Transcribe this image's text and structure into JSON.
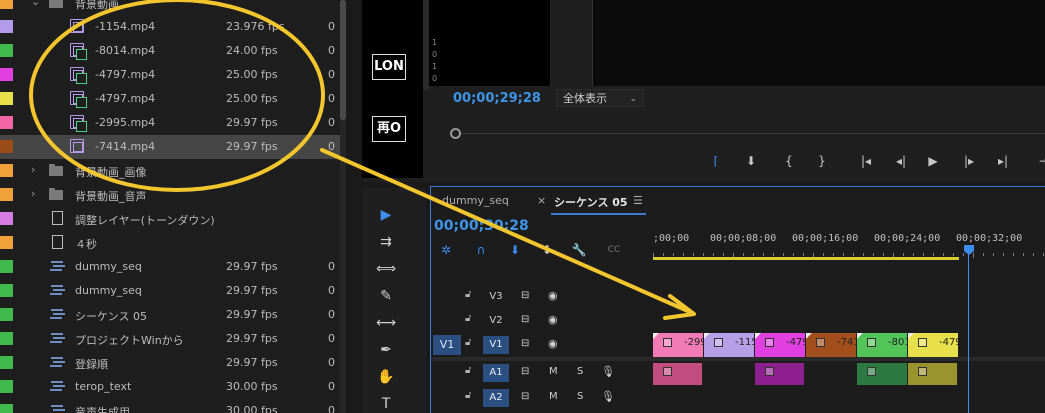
{
  "project": {
    "rows": [
      {
        "kind": "folder",
        "expanded": true,
        "indent": 1,
        "name": "背景動画",
        "fps": "",
        "extra": "",
        "swatch": "#f0a23a"
      },
      {
        "kind": "clip",
        "indent": 2,
        "name": "-1154.mp4",
        "fps": "23.976 fps",
        "extra": "0",
        "swatch": "#b29be8"
      },
      {
        "kind": "clipv",
        "indent": 2,
        "name": "-8014.mp4",
        "fps": "24.00 fps",
        "extra": "0",
        "swatch": "#3fb94e"
      },
      {
        "kind": "clipv",
        "indent": 2,
        "name": "-4797.mp4",
        "fps": "25.00 fps",
        "extra": "0",
        "swatch": "#e040e0"
      },
      {
        "kind": "clipv",
        "indent": 2,
        "name": "-4797.mp4",
        "fps": "25.00 fps",
        "extra": "0",
        "swatch": "#e8e04a"
      },
      {
        "kind": "clipv",
        "indent": 2,
        "name": "-2995.mp4",
        "fps": "29.97 fps",
        "extra": "0",
        "swatch": "#f266a6"
      },
      {
        "kind": "clip",
        "indent": 2,
        "name": "-7414.mp4",
        "fps": "29.97 fps",
        "extra": "0",
        "swatch": "#9a4b18",
        "selected": true
      },
      {
        "kind": "folder",
        "expanded": false,
        "indent": 1,
        "name": "背景動画_画像",
        "fps": "",
        "extra": "",
        "swatch": "#f0a23a"
      },
      {
        "kind": "folder",
        "expanded": false,
        "indent": 1,
        "name": "背景動画_音声",
        "fps": "",
        "extra": "",
        "swatch": "#f0a23a"
      },
      {
        "kind": "doc",
        "indent": 1,
        "name": "調整レイヤー(トーンダウン)",
        "fps": "",
        "extra": "",
        "swatch": "#d77ce3"
      },
      {
        "kind": "doc",
        "indent": 1,
        "name": "４秒",
        "fps": "",
        "extra": "",
        "swatch": "#f0a23a"
      },
      {
        "kind": "seq",
        "indent": 1,
        "name": "dummy_seq",
        "fps": "29.97 fps",
        "extra": "0",
        "swatch": "#3fb94e"
      },
      {
        "kind": "seq",
        "indent": 1,
        "name": "dummy_seq",
        "fps": "29.97 fps",
        "extra": "0",
        "swatch": "#3fb94e"
      },
      {
        "kind": "seq",
        "indent": 1,
        "name": "シーケンス 05",
        "fps": "29.97 fps",
        "extra": "0",
        "swatch": "#3fb94e"
      },
      {
        "kind": "seq",
        "indent": 1,
        "name": "プロジェクトWinから",
        "fps": "29.97 fps",
        "extra": "0",
        "swatch": "#3fb94e"
      },
      {
        "kind": "seq",
        "indent": 1,
        "name": "登録順",
        "fps": "29.97 fps",
        "extra": "0",
        "swatch": "#3fb94e"
      },
      {
        "kind": "seq",
        "indent": 1,
        "name": "terop_text",
        "fps": "30.00 fps",
        "extra": "0",
        "swatch": "#3fb94e"
      },
      {
        "kind": "seq",
        "indent": 1,
        "name": "音声生成用",
        "fps": "30.00 fps",
        "extra": "0",
        "swatch": "#3fb94e"
      }
    ]
  },
  "monitor": {
    "left_boxes": [
      "LON",
      "再O"
    ],
    "ruler_numbers": [
      "1",
      "0",
      "1",
      "0"
    ],
    "timecode": "00;00;29;28",
    "zoom_label": "全体表示",
    "controls": [
      {
        "name": "mark-in-icon",
        "glyph": "⌈",
        "color": "#3a8ef2"
      },
      {
        "name": "add-marker-icon",
        "glyph": "⬇",
        "color": "#c8c8c8"
      },
      {
        "name": "mark-in-brace-icon",
        "glyph": "{",
        "color": "#c8c8c8"
      },
      {
        "name": "mark-out-brace-icon",
        "glyph": "}",
        "color": "#c8c8c8"
      },
      {
        "name": "go-to-in-icon",
        "glyph": "|◂",
        "color": "#c8c8c8"
      },
      {
        "name": "step-back-icon",
        "glyph": "◂|",
        "color": "#c8c8c8"
      },
      {
        "name": "play-icon",
        "glyph": "▶",
        "color": "#c8c8c8"
      },
      {
        "name": "step-forward-icon",
        "glyph": "|▸",
        "color": "#c8c8c8"
      },
      {
        "name": "go-to-out-icon",
        "glyph": "▸|",
        "color": "#c8c8c8"
      },
      {
        "name": "insert-icon",
        "glyph": "⇥",
        "color": "#c8c8c8"
      }
    ]
  },
  "tools": [
    {
      "name": "selection-tool-icon",
      "glyph": "▶",
      "active": true
    },
    {
      "name": "track-select-tool-icon",
      "glyph": "⇉",
      "active": false
    },
    {
      "name": "ripple-edit-tool-icon",
      "glyph": "⟺",
      "active": false
    },
    {
      "name": "razor-tool-icon",
      "glyph": "✎",
      "active": false
    },
    {
      "name": "slip-tool-icon",
      "glyph": "⟷",
      "active": false
    },
    {
      "name": "pen-tool-icon",
      "glyph": "✒",
      "active": false
    },
    {
      "name": "hand-tool-icon",
      "glyph": "✋",
      "active": false
    },
    {
      "name": "type-tool-icon",
      "glyph": "T",
      "active": false
    }
  ],
  "timeline": {
    "tabs": [
      {
        "label": "dummy_seq",
        "active": false
      },
      {
        "label": "×",
        "active": false
      },
      {
        "label": "シーケンス 05",
        "active": true
      },
      {
        "label": "☰",
        "active": false
      }
    ],
    "timecode": "00;00;30;28",
    "controls": [
      {
        "name": "snap-icon",
        "glyph": "✲",
        "color": "#3a8ef2"
      },
      {
        "name": "linked-selection-icon",
        "glyph": "∩",
        "color": "#3a8ef2"
      },
      {
        "name": "add-marker-icon",
        "glyph": "⬇",
        "color": "#3a8ef2"
      },
      {
        "name": "marker-icon",
        "glyph": "⬇",
        "color": "#c8c8c8"
      },
      {
        "name": "wrench-icon",
        "glyph": "🔧",
        "color": "#c8c8c8"
      },
      {
        "name": "captions-icon",
        "glyph": "CC",
        "color": "#777"
      }
    ],
    "ruler_labels": [
      ";00;00",
      "00;00;08;00",
      "00;00;16;00",
      "00;00;24;00",
      "00;00;32;00"
    ],
    "tracks": [
      {
        "id": "V3",
        "type": "video",
        "src": "",
        "on": false
      },
      {
        "id": "V2",
        "type": "video",
        "src": "",
        "on": false
      },
      {
        "id": "V1",
        "type": "video",
        "src": "V1",
        "on": true
      },
      {
        "id": "A1",
        "type": "audio",
        "src": "",
        "on": true
      },
      {
        "id": "A2",
        "type": "audio",
        "src": "",
        "on": true
      }
    ],
    "track_labels": {
      "m": "M",
      "s": "S"
    },
    "video_clips": [
      {
        "name": "-299",
        "color": "#f27ab6"
      },
      {
        "name": "-115",
        "color": "#b69fe6"
      },
      {
        "name": "-479",
        "color": "#e040e0"
      },
      {
        "name": "-741",
        "color": "#a34f1d"
      },
      {
        "name": "-801",
        "color": "#53c457"
      },
      {
        "name": "-479",
        "color": "#e8e04a"
      }
    ],
    "audio_clips": [
      {
        "color": "#c24d80"
      },
      {
        "color": "#8e1f8e"
      },
      {
        "color": "#2c7a42"
      },
      {
        "color": "#9b932e"
      }
    ]
  },
  "overlay": {
    "ellipse_color": "#f3c62e",
    "arrow_color": "#f3c62e"
  }
}
